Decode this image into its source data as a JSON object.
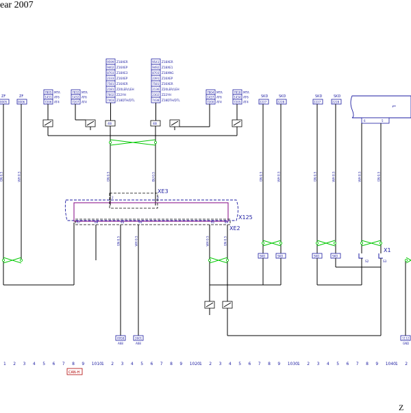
{
  "title": "ear 2007",
  "corner_mark": "Z",
  "colors": {
    "wire": "#000000",
    "text": "#1a1aa0",
    "splice": "#00c800",
    "connector": "#1a1aa0",
    "harness": "#800080",
    "can_label": "#b00000",
    "cloud": "#1a1aa0"
  },
  "top_labels": [
    "ZF",
    "ZF",
    "SKD",
    "SKD",
    "SKD",
    "SKD"
  ],
  "top_codes": [
    "0005",
    "0006",
    "2227",
    "2228",
    "2227",
    "2228"
  ],
  "small_tables": [
    {
      "codes": [
        "7805",
        "1431",
        "7206"
      ],
      "labels": [
        "MTA",
        "AT6",
        "AT4"
      ]
    },
    {
      "codes": [
        "7832",
        "1432",
        "7207"
      ],
      "labels": [
        "MTA",
        "AT6",
        "AT4"
      ]
    },
    {
      "codes": [
        "7804",
        "1437",
        "7200"
      ],
      "labels": [
        "MTA",
        "AT6",
        "AT4"
      ]
    },
    {
      "codes": [
        "7818",
        "1434",
        "7205"
      ],
      "labels": [
        "MTA",
        "AT6",
        "AT4"
      ]
    }
  ],
  "option_tables": [
    {
      "codes": [
        "9599",
        "9402",
        "8703",
        "2333",
        "7581",
        "2181",
        "7602",
        "7403"
      ],
      "labels": [
        "Z18XER",
        "Z16XEP",
        "Z18XE3",
        "Z16XEP",
        "Z16XER",
        "Z20LER/LEH",
        "Z22YH",
        "Z18DTH/DTL"
      ]
    },
    {
      "codes": [
        "9541",
        "9492",
        "8703",
        "2391",
        "7581",
        "2136",
        "2302",
        "7438"
      ],
      "labels": [
        "Z18XER",
        "Z18XE1",
        "Z18XNG",
        "Z16XEP",
        "Z16XER",
        "Z20LER/LEH",
        "Z22YH",
        "Z18DTH/DTL"
      ]
    }
  ],
  "pins": [
    "4B",
    "4B",
    "8",
    "8"
  ],
  "wire_labels": [
    "GN 0.5",
    "WH 0.5",
    "GN 0.5",
    "BU 0.5",
    "GN 0.5",
    "WH 0.5",
    "GN 0.5",
    "WH 0.5",
    "WH 0.5",
    "GN 0.5",
    "GN 0.5",
    "WH 0.5",
    "WH 0.5",
    "GN 0.5"
  ],
  "connectors": [
    "XE3",
    "X125",
    "XE2",
    "X1"
  ],
  "connector_pins": [
    "67",
    "68",
    "93",
    "94",
    "61",
    "89",
    "2",
    "3"
  ],
  "x1_pins": [
    "S2",
    "S3"
  ],
  "bottom_codes": [
    "SKD",
    "SKD",
    "SKD",
    "SKD"
  ],
  "ground_blocks": [
    {
      "code": "0958",
      "sub": "A68"
    },
    {
      "code": "2601",
      "sub": "A68"
    },
    {
      "code": "1112",
      "sub": "GND"
    }
  ],
  "ruler": [
    "1",
    "2",
    "3",
    "4",
    "5",
    "6",
    "7",
    "8",
    "9",
    "1010",
    "1",
    "2",
    "3",
    "4",
    "5",
    "6",
    "7",
    "8",
    "9",
    "1020",
    "1",
    "2",
    "3",
    "4",
    "5",
    "6",
    "7",
    "8",
    "9",
    "1030",
    "1",
    "2",
    "3",
    "4",
    "5",
    "6",
    "7",
    "8",
    "9",
    "1040",
    "1",
    "2"
  ],
  "can_label": "CAN-H"
}
